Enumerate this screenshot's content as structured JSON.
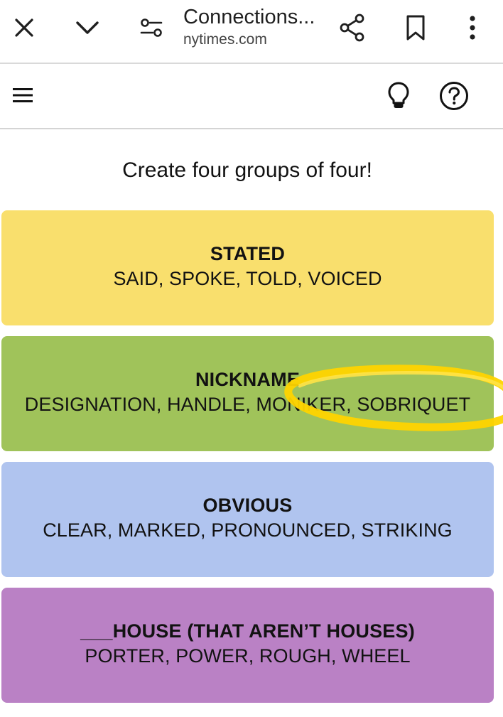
{
  "browser": {
    "tab_title": "Connections...",
    "url": "nytimes.com",
    "icons": {
      "close": "close-icon",
      "collapse": "chevron-down-icon",
      "page_settings": "sliders-icon",
      "share": "share-icon",
      "bookmark": "bookmark-icon",
      "more": "more-vertical-icon"
    }
  },
  "header": {
    "icons": {
      "menu": "hamburger-icon",
      "hint": "lightbulb-icon",
      "help": "question-circle-icon"
    }
  },
  "game": {
    "instructions": "Create four groups of four!",
    "groups": [
      {
        "title": "STATED",
        "words": "SAID, SPOKE, TOLD, VOICED",
        "color": "#f9df6d"
      },
      {
        "title": "NICKNAME",
        "words": "DESIGNATION, HANDLE, MONIKER, SOBRIQUET",
        "color": "#a0c35a"
      },
      {
        "title": "OBVIOUS",
        "words": "CLEAR, MARKED, PRONOUNCED, STRIKING",
        "color": "#b0c4ef"
      },
      {
        "title": "___HOUSE (THAT AREN’T HOUSES)",
        "words": "PORTER, POWER, ROUGH, WHEEL",
        "color": "#ba81c5"
      }
    ]
  },
  "annotation": {
    "type": "hand-drawn-ellipse",
    "color": "#ffd400"
  }
}
